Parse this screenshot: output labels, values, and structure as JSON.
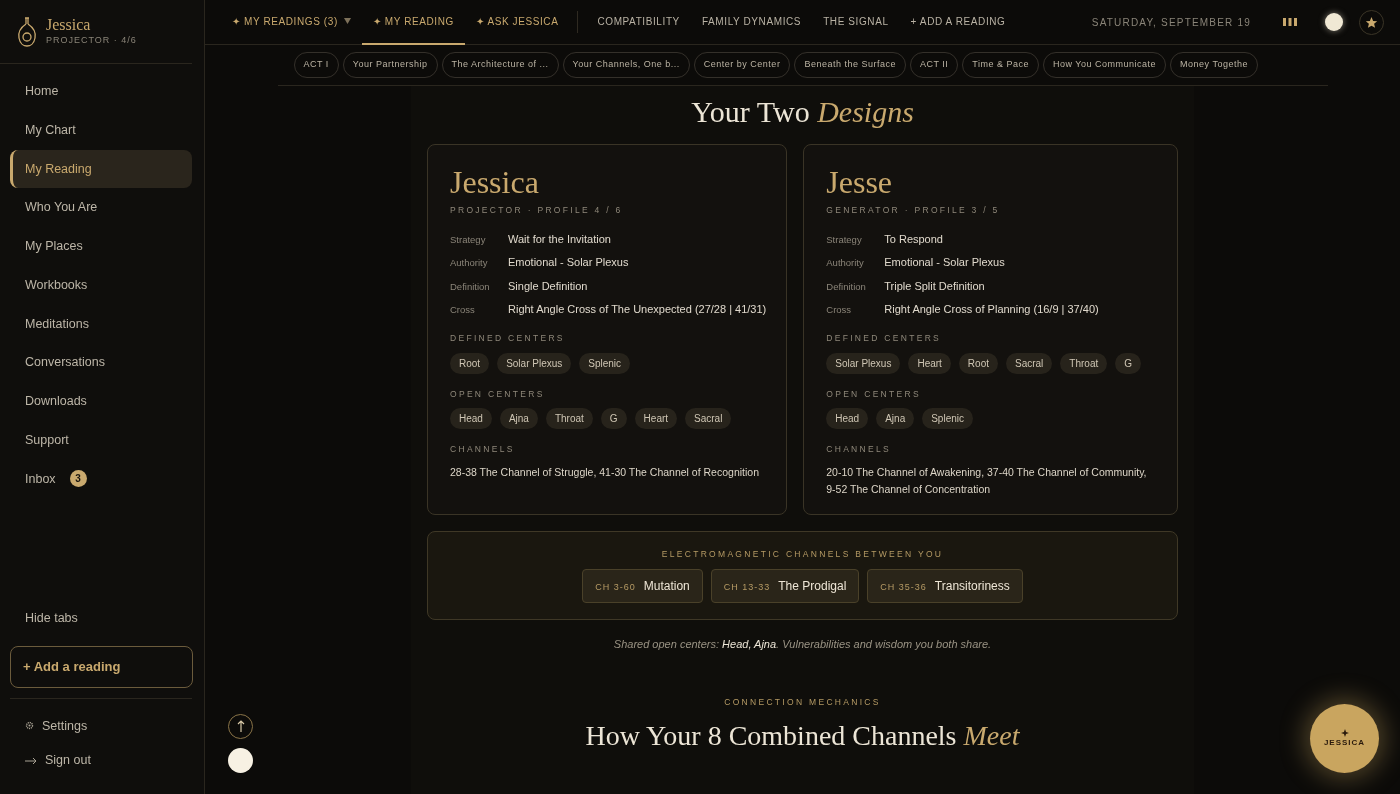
{
  "brand": {
    "name": "Jessica",
    "subtitle": "PROJECTOR · 4/6"
  },
  "sidebar": {
    "items": [
      {
        "label": "Home",
        "selected": false
      },
      {
        "label": "My Chart",
        "selected": false
      },
      {
        "label": "My Reading",
        "selected": true
      },
      {
        "label": "Who You Are",
        "selected": false
      },
      {
        "label": "My Places",
        "selected": false
      },
      {
        "label": "Workbooks",
        "selected": false
      },
      {
        "label": "Meditations",
        "selected": false
      },
      {
        "label": "Conversations",
        "selected": false
      },
      {
        "label": "Downloads",
        "selected": false
      },
      {
        "label": "Support",
        "selected": false
      },
      {
        "label": "Inbox",
        "selected": false,
        "badge": "3"
      }
    ],
    "hide_tabs": "Hide tabs",
    "add_button": "+ Add a reading",
    "footer_links": [
      {
        "kind": "settings",
        "label": "Settings"
      },
      {
        "kind": "signout",
        "label": "Sign out"
      }
    ]
  },
  "topnav": {
    "primary_tabs": [
      {
        "label": "✦ MY READINGS (3)",
        "selected": false,
        "dropdown": true
      },
      {
        "label": "✦ MY READING",
        "selected": true,
        "dropdown": false
      },
      {
        "label": "✦ ASK JESSICA",
        "selected": false,
        "dropdown": false
      }
    ],
    "secondary_tabs": [
      {
        "label": "COMPATIBILITY",
        "selected": false
      },
      {
        "label": "FAMILY DYNAMICS",
        "selected": false
      },
      {
        "label": "THE SIGNAL",
        "selected": false
      },
      {
        "label": "+ ADD A READING",
        "selected": false
      }
    ],
    "date": "SATURDAY, SEPTEMBER 19"
  },
  "section_tabs": [
    "ACT I",
    "Your Partnership",
    "The Architecture of ...",
    "Your Channels, One b...",
    "Center by Center",
    "Beneath the Surface",
    "ACT II",
    "Time & Pace",
    "How You Communicate",
    "Money Togethe"
  ],
  "designs": {
    "title": "Your Two *Designs*",
    "people": [
      {
        "name": "Jessica",
        "type_profile": "PROJECTOR · PROFILE 4 / 6",
        "fields": [
          {
            "label": "Strategy",
            "value": "Wait for the Invitation"
          },
          {
            "label": "Authority",
            "value": "Emotional - Solar Plexus"
          },
          {
            "label": "Definition",
            "value": "Single Definition"
          },
          {
            "label": "Cross",
            "value": "Right Angle Cross of The Unexpected (27/28 | 41/31)"
          }
        ],
        "defined_label": "DEFINED CENTERS",
        "defined": [
          "Root",
          "Solar Plexus",
          "Splenic"
        ],
        "open_label": "OPEN CENTERS",
        "open": [
          "Head",
          "Ajna",
          "Throat",
          "G",
          "Heart",
          "Sacral"
        ],
        "channels_label": "CHANNELS",
        "channels": "28-38 The Channel of Struggle, 41-30 The Channel of Recognition"
      },
      {
        "name": "Jesse",
        "type_profile": "GENERATOR · PROFILE 3 / 5",
        "fields": [
          {
            "label": "Strategy",
            "value": "To Respond"
          },
          {
            "label": "Authority",
            "value": "Emotional - Solar Plexus"
          },
          {
            "label": "Definition",
            "value": "Triple Split Definition"
          },
          {
            "label": "Cross",
            "value": "Right Angle Cross of Planning (16/9 | 37/40)"
          }
        ],
        "defined_label": "DEFINED CENTERS",
        "defined": [
          "Solar Plexus",
          "Heart",
          "Root",
          "Sacral",
          "Throat",
          "G"
        ],
        "open_label": "OPEN CENTERS",
        "open": [
          "Head",
          "Ajna",
          "Splenic"
        ],
        "channels_label": "CHANNELS",
        "channels": "20-10 The Channel of Awakening, 37-40 The Channel of Community, 9-52 The Channel of Concentration"
      }
    ]
  },
  "electromagnetic": {
    "title": "ELECTROMAGNETIC CHANNELS BETWEEN YOU",
    "channels": [
      {
        "code": "CH 3-60",
        "name": "Mutation"
      },
      {
        "code": "CH 13-33",
        "name": "The Prodigal"
      },
      {
        "code": "CH 35-36",
        "name": "Transitoriness"
      }
    ]
  },
  "note": "Shared open centers: **Head, Ajna**. Vulnerabilities and wisdom you both share.",
  "next_section": {
    "eyebrow": "CONNECTION MECHANICS",
    "title": "How Your 8 Combined Channels *Meet*"
  },
  "assistant": {
    "label": "JESSICA"
  }
}
